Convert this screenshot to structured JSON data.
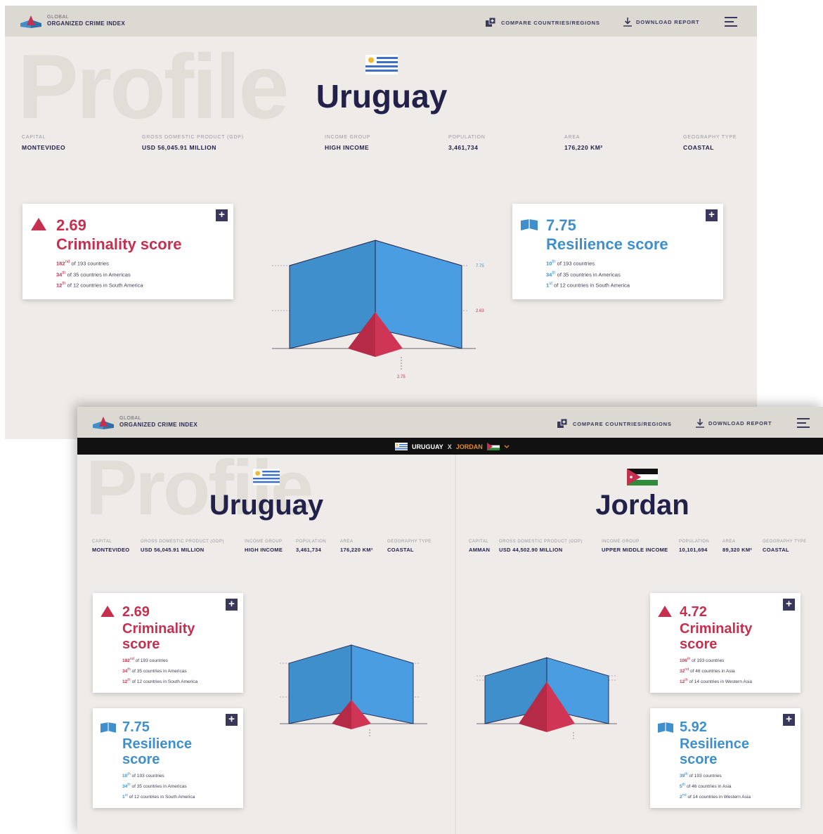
{
  "header": {
    "brand_line1": "GLOBAL",
    "brand_line2": "ORGANIZED CRIME INDEX",
    "compare_label": "COMPARE COUNTRIES/REGIONS",
    "download_label": "DOWNLOAD REPORT"
  },
  "watermark": "Profile",
  "compare_bar": {
    "country_a": "URUGUAY",
    "separator": "X",
    "country_b": "JORDAN"
  },
  "countries": {
    "uruguay": {
      "name": "Uruguay",
      "stats": [
        {
          "label": "CAPITAL",
          "value": "MONTEVIDEO"
        },
        {
          "label": "GROSS DOMESTIC PRODUCT (GDP)",
          "value": "USD 56,045.91 MILLION"
        },
        {
          "label": "INCOME GROUP",
          "value": "HIGH INCOME"
        },
        {
          "label": "POPULATION",
          "value": "3,461,734"
        },
        {
          "label": "AREA",
          "value": "176,220 KM²"
        },
        {
          "label": "GEOGRAPHY TYPE",
          "value": "COASTAL"
        }
      ],
      "criminality": {
        "score": "2.69",
        "title": "Criminality score",
        "title_line1": "Criminality",
        "title_line2": "score",
        "ranks": [
          {
            "n": "182",
            "sup": "nd",
            "text": " of 193 countries"
          },
          {
            "n": "34",
            "sup": "th",
            "text": " of 35 countries in Americas"
          },
          {
            "n": "12",
            "sup": "th",
            "text": " of 12 countries in South America"
          }
        ]
      },
      "resilience": {
        "score": "7.75",
        "title": "Resilience score",
        "title_line1": "Resilience",
        "title_line2": "score",
        "ranks": [
          {
            "n": "10",
            "sup": "th",
            "text": " of 193 countries"
          },
          {
            "n": "34",
            "sup": "th",
            "text": " of 35 countries in Americas"
          },
          {
            "n": "1",
            "sup": "st",
            "text": " of 12 countries in South America"
          }
        ]
      },
      "chart_labels": {
        "resilience": "7.75",
        "criminality_right": "2.63",
        "criminality_bottom": "2.75"
      }
    },
    "jordan": {
      "name": "Jordan",
      "stats": [
        {
          "label": "CAPITAL",
          "value": "AMMAN"
        },
        {
          "label": "GROSS DOMESTIC PRODUCT (GDP)",
          "value": "USD 44,502.90 MILLION"
        },
        {
          "label": "INCOME GROUP",
          "value": "UPPER MIDDLE INCOME"
        },
        {
          "label": "POPULATION",
          "value": "10,101,694"
        },
        {
          "label": "AREA",
          "value": "89,320 KM²"
        },
        {
          "label": "GEOGRAPHY TYPE",
          "value": "COASTAL"
        }
      ],
      "criminality": {
        "score": "4.72",
        "title_line1": "Criminality",
        "title_line2": "score",
        "ranks": [
          {
            "n": "106",
            "sup": "th",
            "text": " of 193 countries"
          },
          {
            "n": "32",
            "sup": "nd",
            "text": " of 46 countries in Asia"
          },
          {
            "n": "12",
            "sup": "th",
            "text": " of 14 countries in Western Asia"
          }
        ]
      },
      "resilience": {
        "score": "5.92",
        "title_line1": "Resilience",
        "title_line2": "score",
        "ranks": [
          {
            "n": "39",
            "sup": "th",
            "text": " of 193 countries"
          },
          {
            "n": "5",
            "sup": "th",
            "text": " of 46 countries in Asia"
          },
          {
            "n": "2",
            "sup": "nd",
            "text": " of 14 countries in Western Asia"
          }
        ]
      },
      "chart_labels": {
        "criminality_bottom": "4.72"
      }
    }
  },
  "colors": {
    "criminality": "#c5304f",
    "resilience": "#3e8fcc",
    "navy": "#22214a",
    "background": "#eeebe8"
  }
}
